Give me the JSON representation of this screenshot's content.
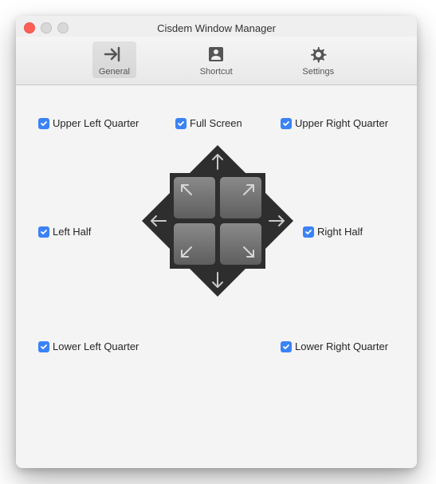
{
  "window": {
    "title": "Cisdem Window Manager"
  },
  "toolbar": {
    "general": "General",
    "shortcut": "Shortcut",
    "settings": "Settings"
  },
  "options": {
    "upperLeft": "Upper Left Quarter",
    "fullScreen": "Full Screen",
    "upperRight": "Upper Right Quarter",
    "leftHalf": "Left Half",
    "rightHalf": "Right Half",
    "lowerLeft": "Lower Left Quarter",
    "lowerRight": "Lower Right Quarter"
  },
  "colors": {
    "checkbox": "#3b82f6",
    "diagramFrame": "#2e2e2e"
  }
}
